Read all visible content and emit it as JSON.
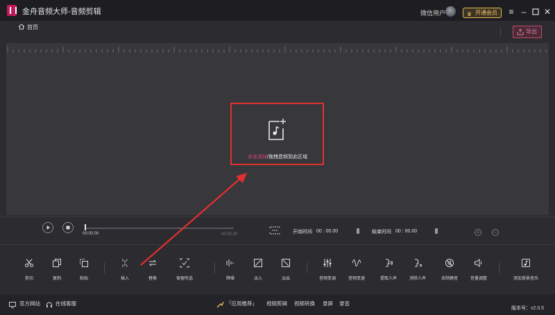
{
  "app": {
    "title": "金舟音频大师-音频剪辑"
  },
  "titlebar": {
    "username": "微信用户",
    "vip_label": "开通会员",
    "menu_icon": "menu-icon",
    "minimize_icon": "minimize-icon",
    "maximize_icon": "maximize-icon",
    "close_icon": "close-icon"
  },
  "subheader": {
    "home_label": "首页",
    "export_label": "导出"
  },
  "dropzone": {
    "link_text": "点击添加",
    "rest_text": "/拖拽音频到此区域"
  },
  "playback": {
    "current_time": "00:00.00",
    "end_time": "00:00.00",
    "start_label": "开始时间",
    "start_value": "00 : 00.00",
    "end_label": "结束时间",
    "end_value": "00 : 00.00"
  },
  "tools": [
    {
      "label": "剪切",
      "icon": "scissors-icon"
    },
    {
      "label": "复制",
      "icon": "copy-icon"
    },
    {
      "label": "粘贴",
      "icon": "paste-icon"
    },
    {
      "label": "插入",
      "icon": "insert-icon"
    },
    {
      "label": "替换",
      "icon": "replace-icon"
    },
    {
      "label": "保留所选",
      "icon": "keep-selection-icon"
    },
    {
      "label": "降噪",
      "icon": "denoise-icon"
    },
    {
      "label": "淡入",
      "icon": "fade-in-icon"
    },
    {
      "label": "淡出",
      "icon": "fade-out-icon"
    },
    {
      "label": "音频变调",
      "icon": "pitch-icon"
    },
    {
      "label": "音频变速",
      "icon": "speed-icon"
    },
    {
      "label": "提取人声",
      "icon": "extract-vocal-icon"
    },
    {
      "label": "消除人声",
      "icon": "remove-vocal-icon"
    },
    {
      "label": "去除静音",
      "icon": "remove-silence-icon"
    },
    {
      "label": "音量调整",
      "icon": "volume-icon"
    },
    {
      "label": "添加背景音乐",
      "icon": "add-bgm-icon"
    }
  ],
  "statusbar": {
    "website": "官方网站",
    "support": "在线客服",
    "recommend": "「应用推荐」",
    "links": [
      "视频剪辑",
      "视频转换",
      "录屏",
      "录音"
    ],
    "version": "版本号：v2.0.5"
  },
  "colors": {
    "accent": "#e4477d",
    "highlight_border": "#e1312f",
    "vip": "#f3c06a"
  }
}
